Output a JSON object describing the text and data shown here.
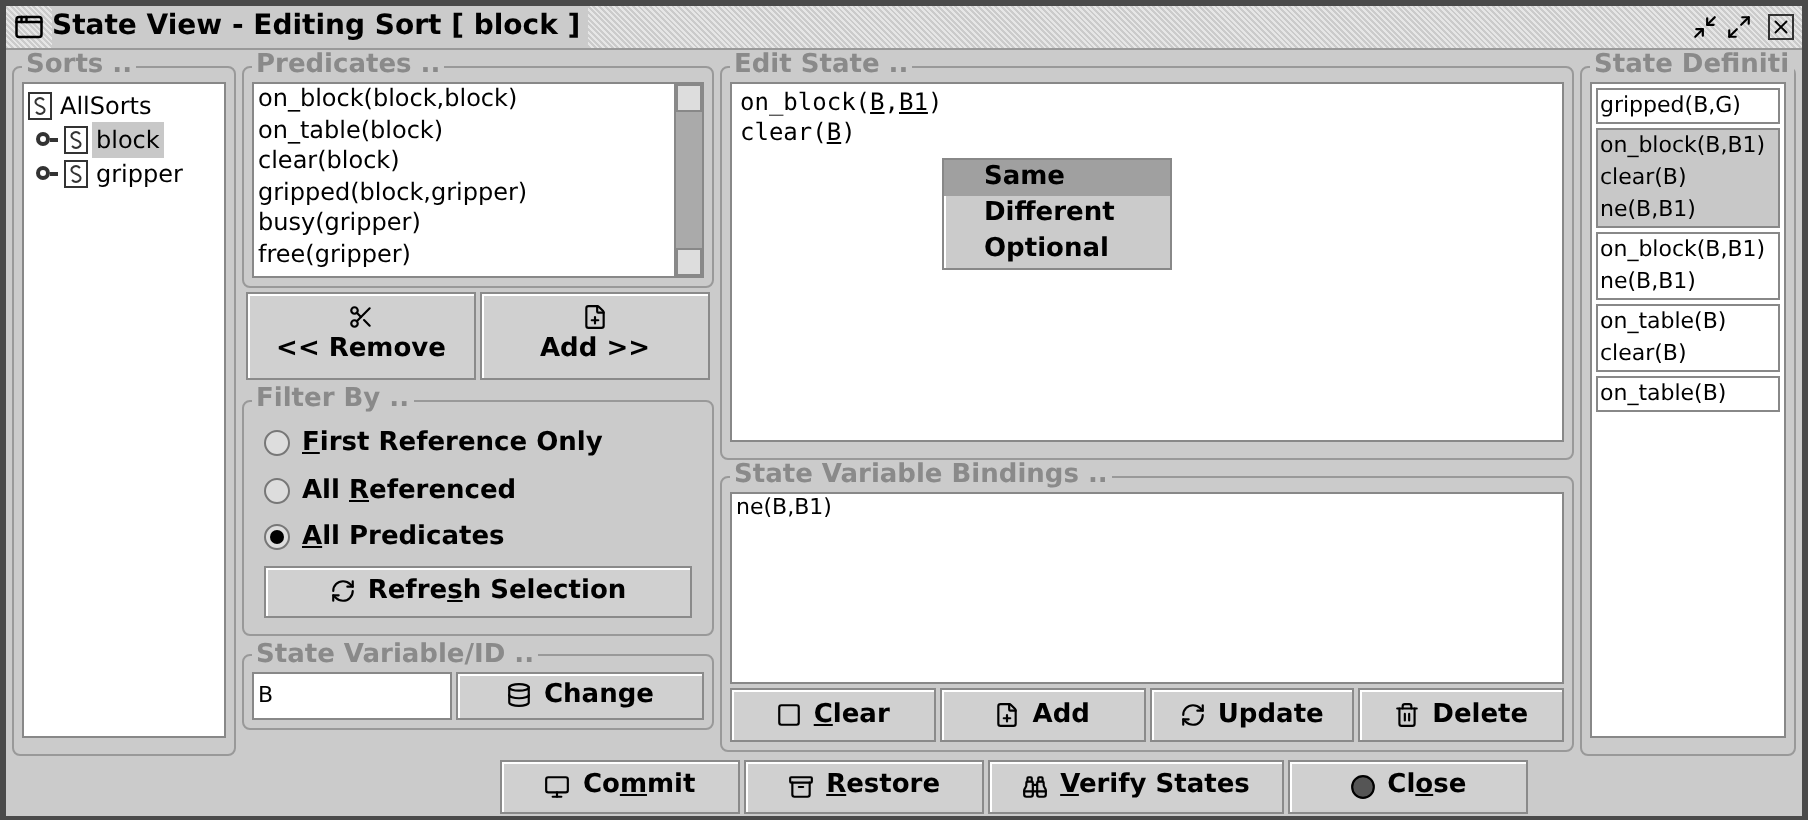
{
  "window": {
    "title": "State View - Editing Sort [ block ]"
  },
  "sorts": {
    "title": "Sorts ..",
    "tree": [
      {
        "label": "AllSorts",
        "selected": false,
        "children": [
          {
            "label": "block",
            "selected": true
          },
          {
            "label": "gripper",
            "selected": false
          }
        ]
      }
    ]
  },
  "predicates": {
    "title": "Predicates ..",
    "items": [
      "on_block(block,block)",
      "on_table(block)",
      "clear(block)",
      "gripped(block,gripper)",
      "busy(gripper)",
      "free(gripper)"
    ],
    "buttons": [
      {
        "kind": "remove",
        "label": "<< Remove"
      },
      {
        "kind": "add",
        "label": "Add >>"
      }
    ]
  },
  "filter": {
    "title": "Filter By ..",
    "options": [
      {
        "key": "F",
        "post": "irst Reference Only",
        "selected": false
      },
      {
        "pre": "All ",
        "key": "R",
        "post": "eferenced",
        "selected": false
      },
      {
        "key": "A",
        "post": "ll Predicates",
        "selected": true
      }
    ],
    "refresh": {
      "pre": "Refre",
      "key": "s",
      "post": "h Selection"
    }
  },
  "state_variable": {
    "title": "State Variable/ID ..",
    "value": "B",
    "button": {
      "pre": "Change"
    }
  },
  "edit_state": {
    "title": "Edit State ..",
    "lines": [
      [
        {
          "t": "on_block("
        },
        {
          "t": "B",
          "u": true
        },
        {
          "t": ","
        },
        {
          "t": "B1",
          "u": true
        },
        {
          "t": ")"
        }
      ],
      [
        {
          "t": "clear("
        },
        {
          "t": "B",
          "u": true
        },
        {
          "t": ")"
        }
      ]
    ],
    "menu": [
      {
        "label": "Same",
        "selected": true
      },
      {
        "label": "Different",
        "selected": false
      },
      {
        "label": "Optional",
        "selected": false
      }
    ]
  },
  "bindings": {
    "title": "State Variable Bindings ..",
    "lines": [
      "ne(B,B1)"
    ],
    "buttons": [
      {
        "kind": "clear",
        "key": "C",
        "post": "lear"
      },
      {
        "kind": "add",
        "pre": "Add"
      },
      {
        "kind": "update",
        "pre": "Update"
      },
      {
        "kind": "delete",
        "pre": "Delete"
      }
    ]
  },
  "definitions": {
    "title": "State Definiti",
    "items": [
      {
        "lines": [
          "gripped(B,G)"
        ],
        "selected": false
      },
      {
        "lines": [
          "on_block(B,B1)",
          "clear(B)",
          "ne(B,B1)"
        ],
        "selected": true
      },
      {
        "lines": [
          "on_block(B,B1)",
          "ne(B,B1)"
        ],
        "selected": false
      },
      {
        "lines": [
          "on_table(B)",
          "clear(B)"
        ],
        "selected": false
      },
      {
        "lines": [
          "on_table(B)"
        ],
        "selected": false
      }
    ]
  },
  "footer": [
    {
      "kind": "commit",
      "pre": "Co",
      "key": "m",
      "post": "mit"
    },
    {
      "kind": "restore",
      "key": "R",
      "post": "estore"
    },
    {
      "kind": "verify",
      "key": "V",
      "post": "erify States"
    },
    {
      "kind": "close",
      "pre": "Cl",
      "key": "o",
      "post": "se"
    }
  ]
}
